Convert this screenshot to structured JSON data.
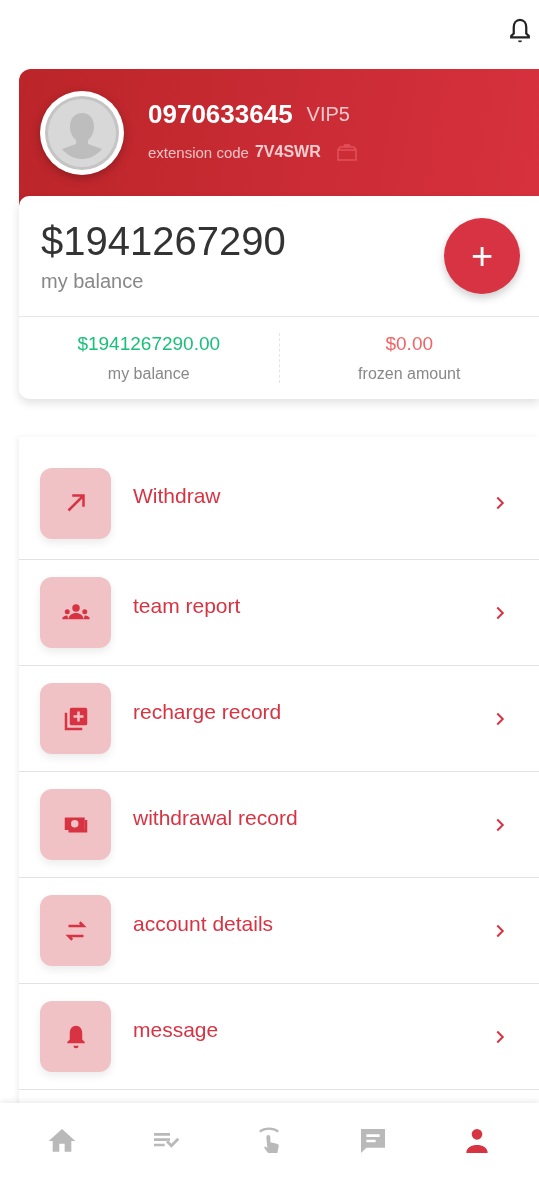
{
  "profile": {
    "phone": "0970633645",
    "level": "VIP5",
    "code_label": "extension code",
    "code": "7V4SWR"
  },
  "balance": {
    "amount": "$1941267290",
    "label": "my balance",
    "add_button": "+"
  },
  "stats": [
    {
      "value": "$1941267290.00",
      "label": "my balance",
      "color": "#19c07a"
    },
    {
      "value": "$0.00",
      "label": "frozen amount",
      "color": "#f06467"
    }
  ],
  "menu": [
    {
      "label": "Withdraw"
    },
    {
      "label": "team report"
    },
    {
      "label": "recharge record"
    },
    {
      "label": "withdrawal record"
    },
    {
      "label": "account details"
    },
    {
      "label": "message"
    }
  ],
  "bottom_nav": [
    {
      "selected": false
    },
    {
      "selected": false
    },
    {
      "selected": false
    },
    {
      "selected": false
    },
    {
      "selected": true
    }
  ]
}
